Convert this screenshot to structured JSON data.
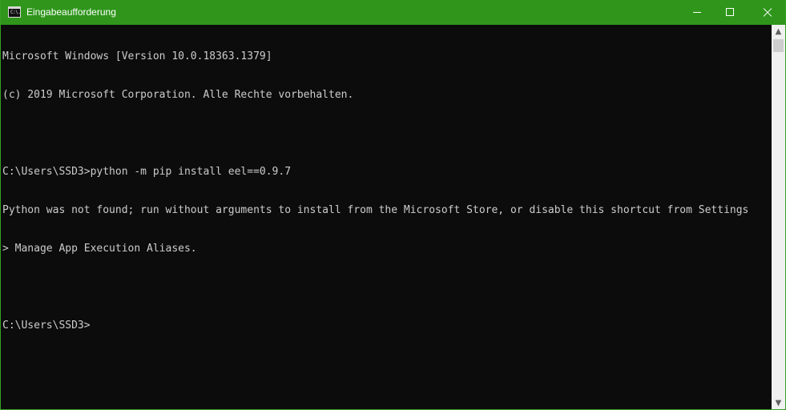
{
  "window": {
    "title": "Eingabeaufforderung",
    "icon_name": "cmd-icon",
    "icon_text": "C:\\.",
    "accent_color": "#2f961b"
  },
  "caption_buttons": {
    "minimize_icon": "minimize-icon",
    "maximize_icon": "maximize-icon",
    "close_icon": "close-icon"
  },
  "console": {
    "lines": [
      "Microsoft Windows [Version 10.0.18363.1379]",
      "(c) 2019 Microsoft Corporation. Alle Rechte vorbehalten.",
      "",
      "C:\\Users\\SSD3>python -m pip install eel==0.9.7",
      "Python was not found; run without arguments to install from the Microsoft Store, or disable this shortcut from Settings",
      "> Manage App Execution Aliases.",
      "",
      "C:\\Users\\SSD3>"
    ]
  },
  "scrollbar": {
    "up_arrow": "▲",
    "down_arrow": "▼"
  }
}
